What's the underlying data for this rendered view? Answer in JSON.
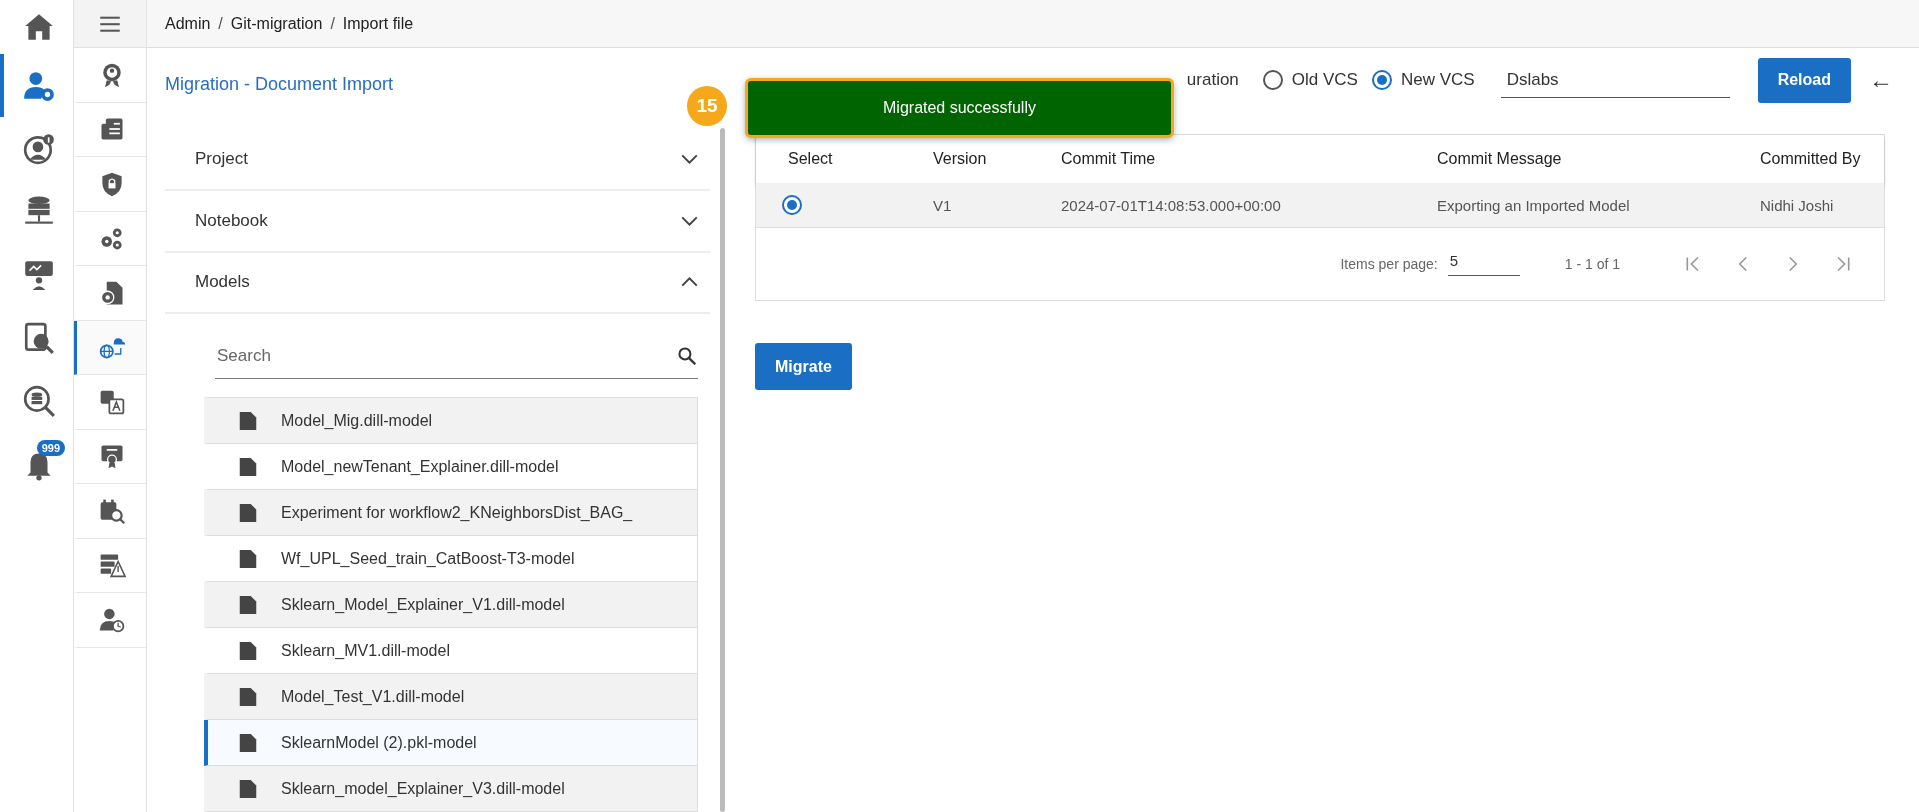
{
  "rail": [
    {
      "selected": false
    },
    {
      "selected": true
    },
    {
      "selected": false
    },
    {
      "selected": false
    },
    {
      "selected": false
    },
    {
      "selected": false
    },
    {
      "selected": false
    },
    {
      "selected": false,
      "badge": "999"
    }
  ],
  "subrail": [
    {
      "selected": false
    },
    {
      "selected": false
    },
    {
      "selected": false
    },
    {
      "selected": false
    },
    {
      "selected": false
    },
    {
      "selected": true
    },
    {
      "selected": false
    },
    {
      "selected": false
    },
    {
      "selected": false
    },
    {
      "selected": false
    },
    {
      "selected": false
    }
  ],
  "breadcrumb": [
    "Admin",
    "Git-migration",
    "Import file"
  ],
  "breadcrumb_separator": "/",
  "title": "Migration - Document Import",
  "accordions": [
    {
      "label": "Project",
      "expanded": false
    },
    {
      "label": "Notebook",
      "expanded": false
    },
    {
      "label": "Models",
      "expanded": true
    }
  ],
  "search": {
    "placeholder": "Search"
  },
  "models": [
    {
      "name": "Model_Mig.dill-model",
      "selected": false
    },
    {
      "name": "Model_newTenant_Explainer.dill-model",
      "selected": false
    },
    {
      "name": "Experiment for workflow2_KNeighborsDist_BAG_",
      "selected": false
    },
    {
      "name": "Wf_UPL_Seed_train_CatBoost-T3-model",
      "selected": false
    },
    {
      "name": "Sklearn_Model_Explainer_V1.dill-model",
      "selected": false
    },
    {
      "name": "Sklearn_MV1.dill-model",
      "selected": false
    },
    {
      "name": "Model_Test_V1.dill-model",
      "selected": false
    },
    {
      "name": "SklearnModel (2).pkl-model",
      "selected": true
    },
    {
      "name": "Sklearn_model_Explainer_V3.dill-model",
      "selected": false
    }
  ],
  "config_label": "uration",
  "vcs": [
    {
      "label": "Old VCS",
      "selected": false
    },
    {
      "label": "New VCS",
      "selected": true
    }
  ],
  "vcs_name": "Dslabs",
  "reload": "Reload",
  "back": "←",
  "toast": {
    "step": "15",
    "message": "Migrated successfully"
  },
  "table": {
    "columns": [
      "Select",
      "Version",
      "Commit Time",
      "Commit Message",
      "Committed By"
    ],
    "rows": [
      {
        "selected": true,
        "cells": [
          "",
          "V1",
          "2024-07-01T14:08:53.000+00:00",
          "Exporting an Imported Model",
          "Nidhi Joshi"
        ]
      }
    ]
  },
  "pager": {
    "label": "Items per page:",
    "size": "5",
    "range": "1 - 1 of 1"
  },
  "migrate": "Migrate"
}
